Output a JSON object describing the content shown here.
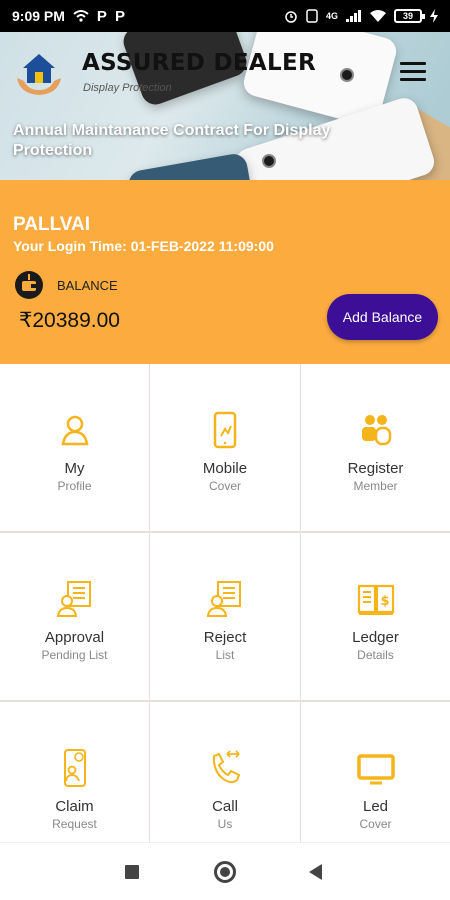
{
  "status_bar": {
    "time": "9:09 PM",
    "left_icons": [
      "wifi-calling-icon",
      "parking-icon",
      "parking-icon"
    ],
    "right_icons": [
      "alarm-icon",
      "sim-icon",
      "signal-icon",
      "wifi-icon",
      "battery-icon",
      "charging-icon"
    ],
    "network_label": "4G",
    "battery_level": "39"
  },
  "header": {
    "title": "ASSURED DEALER",
    "subtitle": "Display Protection",
    "banner_text": "Annual Maintanance Contract For Display Protection",
    "menu_icon": "hamburger-menu-icon",
    "logo_icon": "house-in-hands-logo"
  },
  "account": {
    "name": "PALLVAI",
    "login_time": "Your Login Time: 01-FEB-2022 11:09:00",
    "balance_label": "BALANCE",
    "balance_amount": "₹20389.00",
    "add_balance_label": "Add Balance",
    "balance_icon": "wallet-icon"
  },
  "menu": {
    "items": [
      {
        "title": "My",
        "subtitle": "Profile",
        "icon": "user-icon"
      },
      {
        "title": "Mobile",
        "subtitle": "Cover",
        "icon": "mobile-icon"
      },
      {
        "title": "Register",
        "subtitle": "Member",
        "icon": "members-icon"
      },
      {
        "title": "Approval",
        "subtitle": "Pending List",
        "icon": "approval-list-icon"
      },
      {
        "title": "Reject",
        "subtitle": "List",
        "icon": "reject-list-icon"
      },
      {
        "title": "Ledger",
        "subtitle": "Details",
        "icon": "ledger-book-icon"
      },
      {
        "title": "Claim",
        "subtitle": "Request",
        "icon": "claim-phone-icon"
      },
      {
        "title": "Call",
        "subtitle": "Us",
        "icon": "call-icon"
      },
      {
        "title": "Led",
        "subtitle": "Cover",
        "icon": "tv-icon"
      }
    ]
  },
  "colors": {
    "accent_orange": "#fcab3f",
    "button_purple": "#3d0f97",
    "icon_yellow": "#f5b41a"
  },
  "navbar": {
    "icons": [
      "recents-icon",
      "home-icon",
      "back-icon"
    ]
  }
}
